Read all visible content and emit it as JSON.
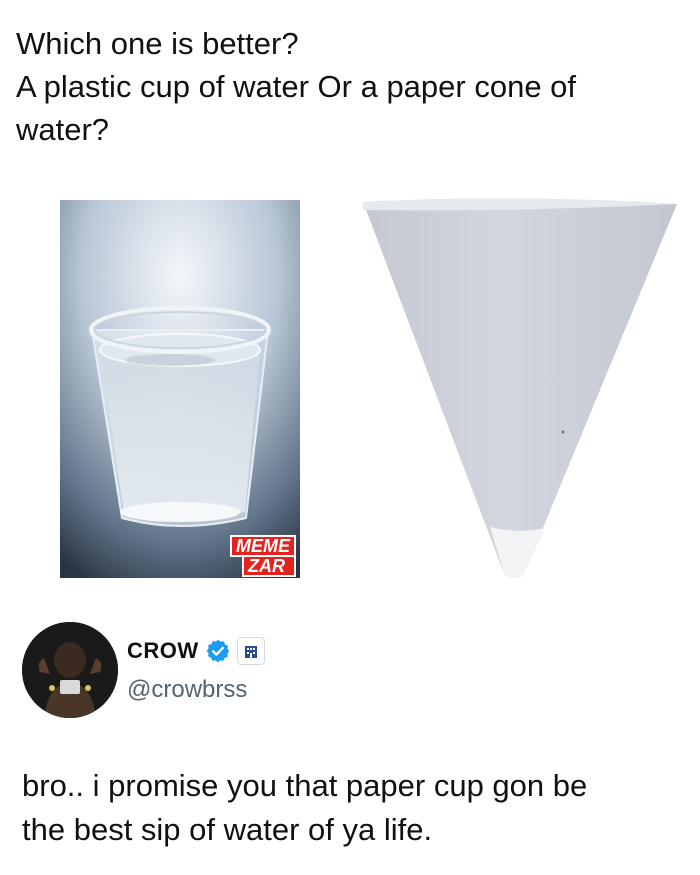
{
  "post": {
    "question_lines": [
      "Which one is better?",
      "A plastic cup of water Or a paper cone of",
      "water?"
    ]
  },
  "images": {
    "left": {
      "watermark_line1": "MEME",
      "watermark_line2": "ZAR"
    },
    "right": {}
  },
  "reply": {
    "name": "CROW",
    "handle": "@crowbrss",
    "text_lines": [
      "bro.. i promise you that paper cup gon be",
      "the best sip of water of ya life."
    ]
  },
  "colors": {
    "verified": "#1d9bf0",
    "handle": "#536471",
    "watermark": "#e4231f"
  }
}
